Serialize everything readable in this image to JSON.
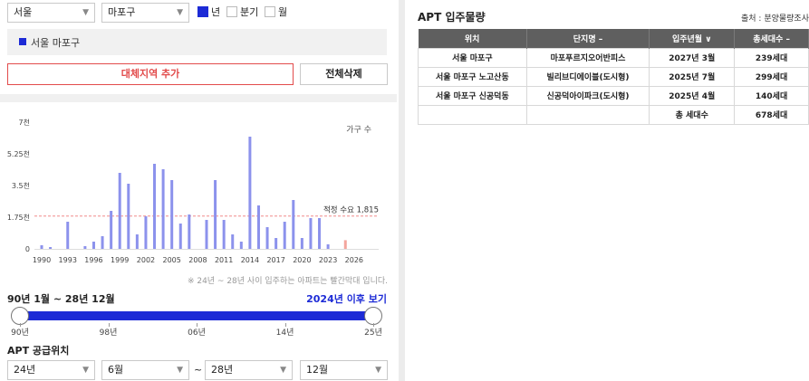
{
  "filters": {
    "city": "서울",
    "district": "마포구",
    "period_options": [
      {
        "label": "년",
        "checked": true
      },
      {
        "label": "분기",
        "checked": false
      },
      {
        "label": "월",
        "checked": false
      }
    ]
  },
  "selected_region": "서울 마포구",
  "buttons": {
    "add_region": "대체지역 추가",
    "clear_all": "전체삭제"
  },
  "chart_note": "※ 24년 ~ 28년 사이 입주하는 아파트는 빨간막대 입니다.",
  "chart_data": {
    "type": "bar",
    "legend": "가구 수",
    "reference_label": "적정 수요 1,815",
    "reference_value": 1815,
    "ylim": [
      0,
      7000
    ],
    "ytick_labels": [
      "0",
      "1.75천",
      "3.5천",
      "5.25천",
      "7천"
    ],
    "ytick_values": [
      0,
      1750,
      3500,
      5250,
      7000
    ],
    "xtick_labels": [
      "1990",
      "1993",
      "1996",
      "1999",
      "2002",
      "2005",
      "2008",
      "2011",
      "2014",
      "2017",
      "2020",
      "2023",
      "2026"
    ],
    "x": [
      1990,
      1991,
      1992,
      1993,
      1994,
      1995,
      1996,
      1997,
      1998,
      1999,
      2000,
      2001,
      2002,
      2003,
      2004,
      2005,
      2006,
      2007,
      2008,
      2009,
      2010,
      2011,
      2012,
      2013,
      2014,
      2015,
      2016,
      2017,
      2018,
      2019,
      2020,
      2021,
      2022,
      2023,
      2024,
      2025,
      2026,
      2027,
      2028
    ],
    "values": [
      200,
      100,
      0,
      1500,
      0,
      150,
      400,
      700,
      2100,
      4200,
      3600,
      800,
      1800,
      4700,
      4400,
      3800,
      1400,
      1900,
      0,
      1600,
      3800,
      1600,
      800,
      400,
      6200,
      2400,
      1200,
      600,
      1500,
      2700,
      600,
      1700,
      1700,
      250,
      0,
      480,
      0,
      0,
      0
    ],
    "highlight_from": 2024,
    "colors": {
      "bar": "#8c92ec",
      "highlight": "#f3a59d",
      "reference": "#f08a8a"
    }
  },
  "range": {
    "label": "90년 1월 ~ 28년 12월",
    "link": "2024년 이후 보기",
    "start_fraction": 0.0,
    "end_fraction": 1.0,
    "ticks": [
      "90년",
      "98년",
      "06년",
      "14년",
      "25년"
    ]
  },
  "supply": {
    "title": "APT 공급위치",
    "from_year": "24년",
    "from_month": "6월",
    "separator": "~",
    "to_year": "28년",
    "to_month": "12월"
  },
  "right": {
    "title": "APT 입주물량",
    "source": "출처 : 분양물량조사",
    "columns": [
      "위치",
      "단지명 –",
      "입주년월 ∨",
      "총세대수 –"
    ],
    "rows": [
      [
        "서울 마포구",
        "마포푸르지오어반피스",
        "2027년 3월",
        "239세대"
      ],
      [
        "서울 마포구 노고산동",
        "빌리브디에이블(도시형)",
        "2025년 7월",
        "299세대"
      ],
      [
        "서울 마포구 신공덕동",
        "신공덕아이파크(도시형)",
        "2025년 4월",
        "140세대"
      ]
    ],
    "total_label": "총 세대수",
    "total_value": "678세대"
  }
}
